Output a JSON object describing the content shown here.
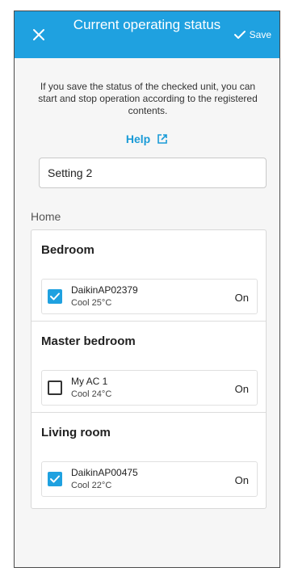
{
  "header": {
    "title": "Current operating status",
    "save_label": "Save"
  },
  "intro_text": "If you save the status of the checked unit, you can start and stop operation according to the registered contents.",
  "help_label": "Help",
  "setting_name": "Setting 2",
  "section_label": "Home",
  "rooms": [
    {
      "name": "Bedroom",
      "unit": {
        "name": "DaikinAP02379",
        "mode": "Cool 25°C",
        "status": "On",
        "checked": true
      }
    },
    {
      "name": "Master bedroom",
      "unit": {
        "name": "My AC 1",
        "mode": "Cool 24°C",
        "status": "On",
        "checked": false
      }
    },
    {
      "name": "Living room",
      "unit": {
        "name": "DaikinAP00475",
        "mode": "Cool 22°C",
        "status": "On",
        "checked": true
      }
    }
  ],
  "colors": {
    "accent": "#1fa1e0",
    "help_link": "#1a9bd7"
  }
}
